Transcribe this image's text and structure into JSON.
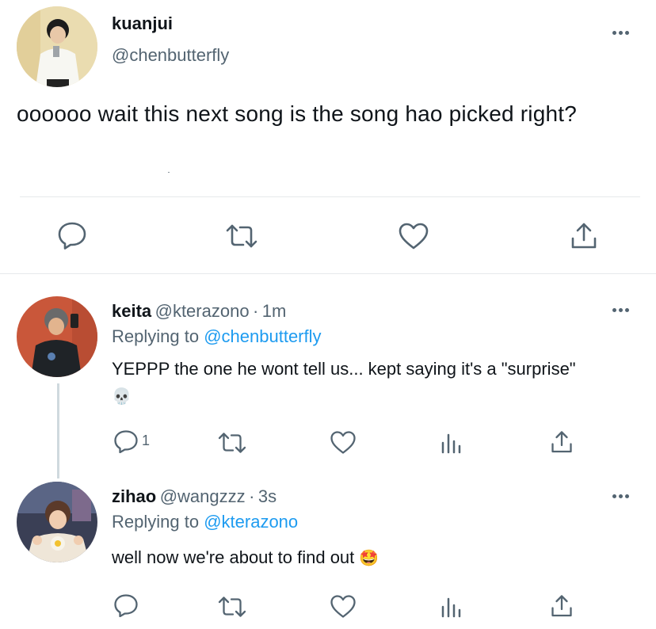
{
  "main_tweet": {
    "display_name": "kuanjui",
    "handle": "@chenbutterfly",
    "text": "oooooo wait this next song is the song hao picked right?"
  },
  "replies": [
    {
      "display_name": "keita",
      "handle": "@kterazono",
      "separator": "·",
      "time": "1m",
      "replying_label": "Replying to",
      "replying_to": "@chenbutterfly",
      "text": "YEPPP the one he wont tell us... kept saying it's a \"surprise\"",
      "emoji": "💀",
      "reply_count": "1"
    },
    {
      "display_name": "zihao",
      "handle": "@wangzzz",
      "separator": "·",
      "time": "3s",
      "replying_label": "Replying to",
      "replying_to": "@kterazono",
      "text": "well now we're about to find out",
      "emoji": "🤩"
    }
  ],
  "icons": {
    "reply": "reply-icon",
    "retweet": "retweet-icon",
    "like": "heart-icon",
    "share": "share-icon",
    "analytics": "analytics-icon",
    "more": "more-icon"
  },
  "colors": {
    "text": "#0f1419",
    "secondary": "#536471",
    "link": "#1d9bf0",
    "divider": "#e6e9eb"
  }
}
